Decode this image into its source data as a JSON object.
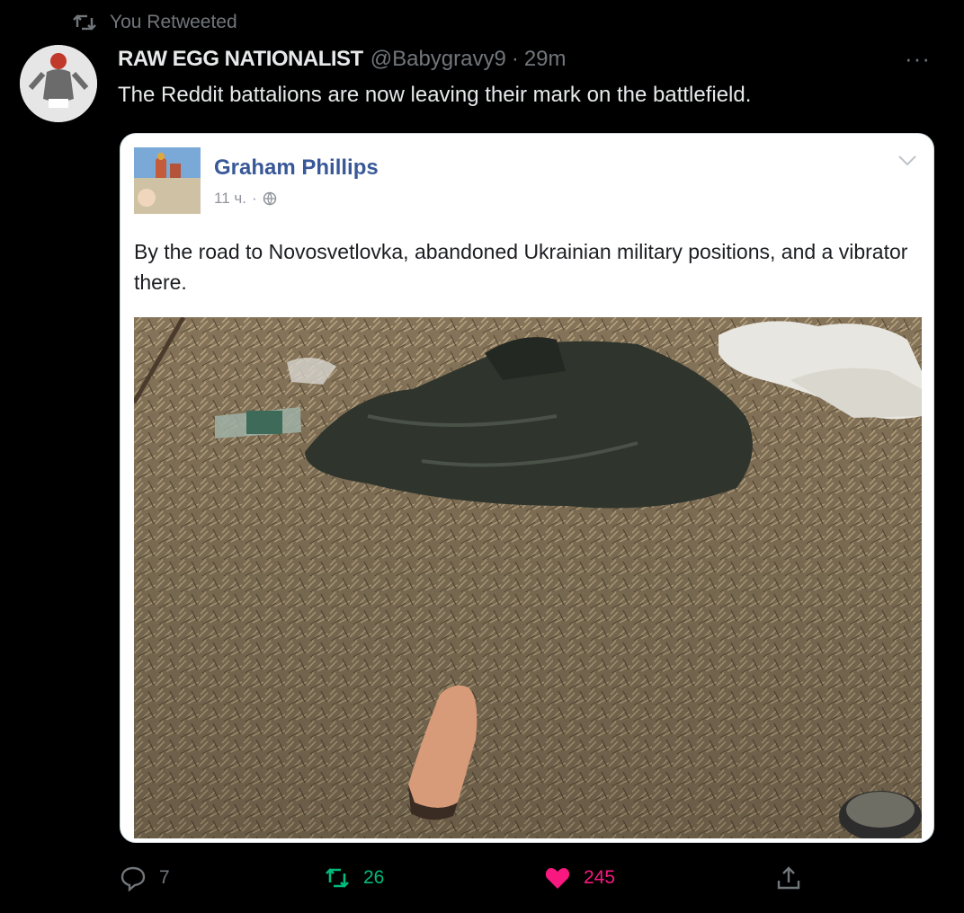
{
  "retweet_header": {
    "label": "You Retweeted"
  },
  "tweet": {
    "author_name": "RAW EGG NATIONALIST",
    "handle": "@Babygravy9",
    "separator": "·",
    "time": "29m",
    "more_label": "···",
    "text": "The Reddit battalions are now leaving their mark on the battlefield."
  },
  "embedded_post": {
    "author": "Graham Phillips",
    "time": "11 ч.",
    "separator": "·",
    "text": "By the road to Novosvetlovka, abandoned Ukrainian military positions, and a vibrator there."
  },
  "actions": {
    "reply_count": "7",
    "retweet_count": "26",
    "like_count": "245"
  },
  "colors": {
    "background": "#000000",
    "muted": "#71767b",
    "retweet_green": "#00ba7c",
    "like_pink": "#f91880",
    "fb_blue": "#385898"
  },
  "icons": [
    "retweet-icon",
    "more-icon",
    "chevron-down-icon",
    "globe-icon",
    "reply-icon",
    "like-icon",
    "share-icon"
  ]
}
